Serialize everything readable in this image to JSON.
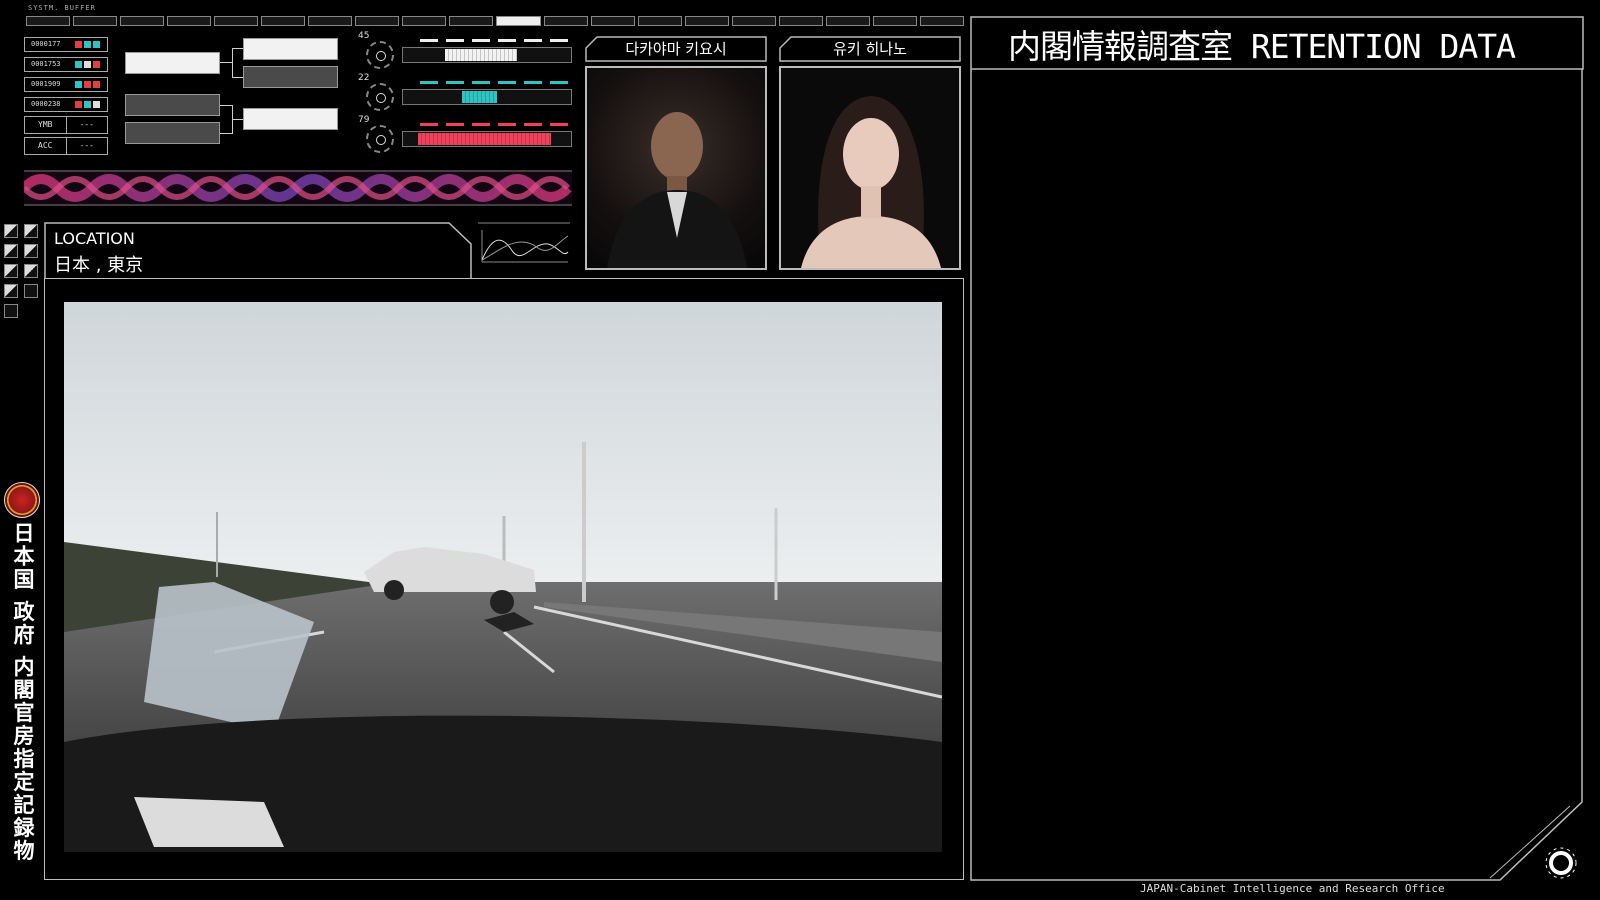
{
  "top_bar": {
    "system_label": "SYSTM. BUFFER",
    "ruler_segments": [
      "",
      "",
      "",
      "",
      "",
      "",
      "",
      "",
      "",
      "",
      "",
      "",
      "",
      "",
      "",
      "",
      "",
      "",
      "",
      ""
    ],
    "active_segment": 10
  },
  "id_list": [
    {
      "id": "0000177",
      "colors": [
        "#e04040",
        "#2ec4c4",
        "#2ec4c4"
      ]
    },
    {
      "id": "0001753",
      "colors": [
        "#2ec4c4",
        "#dddddd",
        "#e04040"
      ]
    },
    {
      "id": "0001909",
      "colors": [
        "#2ec4c4",
        "#e04040",
        "#e04040"
      ]
    },
    {
      "id": "0000238",
      "colors": [
        "#e04040",
        "#2ec4c4",
        "#dddddd"
      ]
    }
  ],
  "key_values": [
    {
      "key": "YMB",
      "value": "---"
    },
    {
      "key": "ACC",
      "value": "---"
    }
  ],
  "gauges": [
    {
      "number": "45",
      "color": "#f2f2f2",
      "fill": 0.44
    },
    {
      "number": "22",
      "color": "#2ec4c4",
      "fill": 0.22
    },
    {
      "number": "79",
      "color": "#f0405a",
      "fill": 0.8
    }
  ],
  "location": {
    "label": "LOCATION",
    "value": "日本 , 東京"
  },
  "persons": [
    {
      "name": "다카야마 키요시"
    },
    {
      "name": "유키 히나노"
    }
  ],
  "retention": {
    "title": "内閣情報調査室 RETENTION DATA"
  },
  "footer": {
    "text": "JAPAN-Cabinet Intelligence and Research Office"
  },
  "vertical": {
    "text": "日本国 政府 内閣官房指定記録物"
  },
  "colors": {
    "accent_cyan": "#2ec4c4",
    "accent_red": "#e04040",
    "wave_magenta": "#c0306a",
    "wave_purple": "#6a3aa0"
  }
}
